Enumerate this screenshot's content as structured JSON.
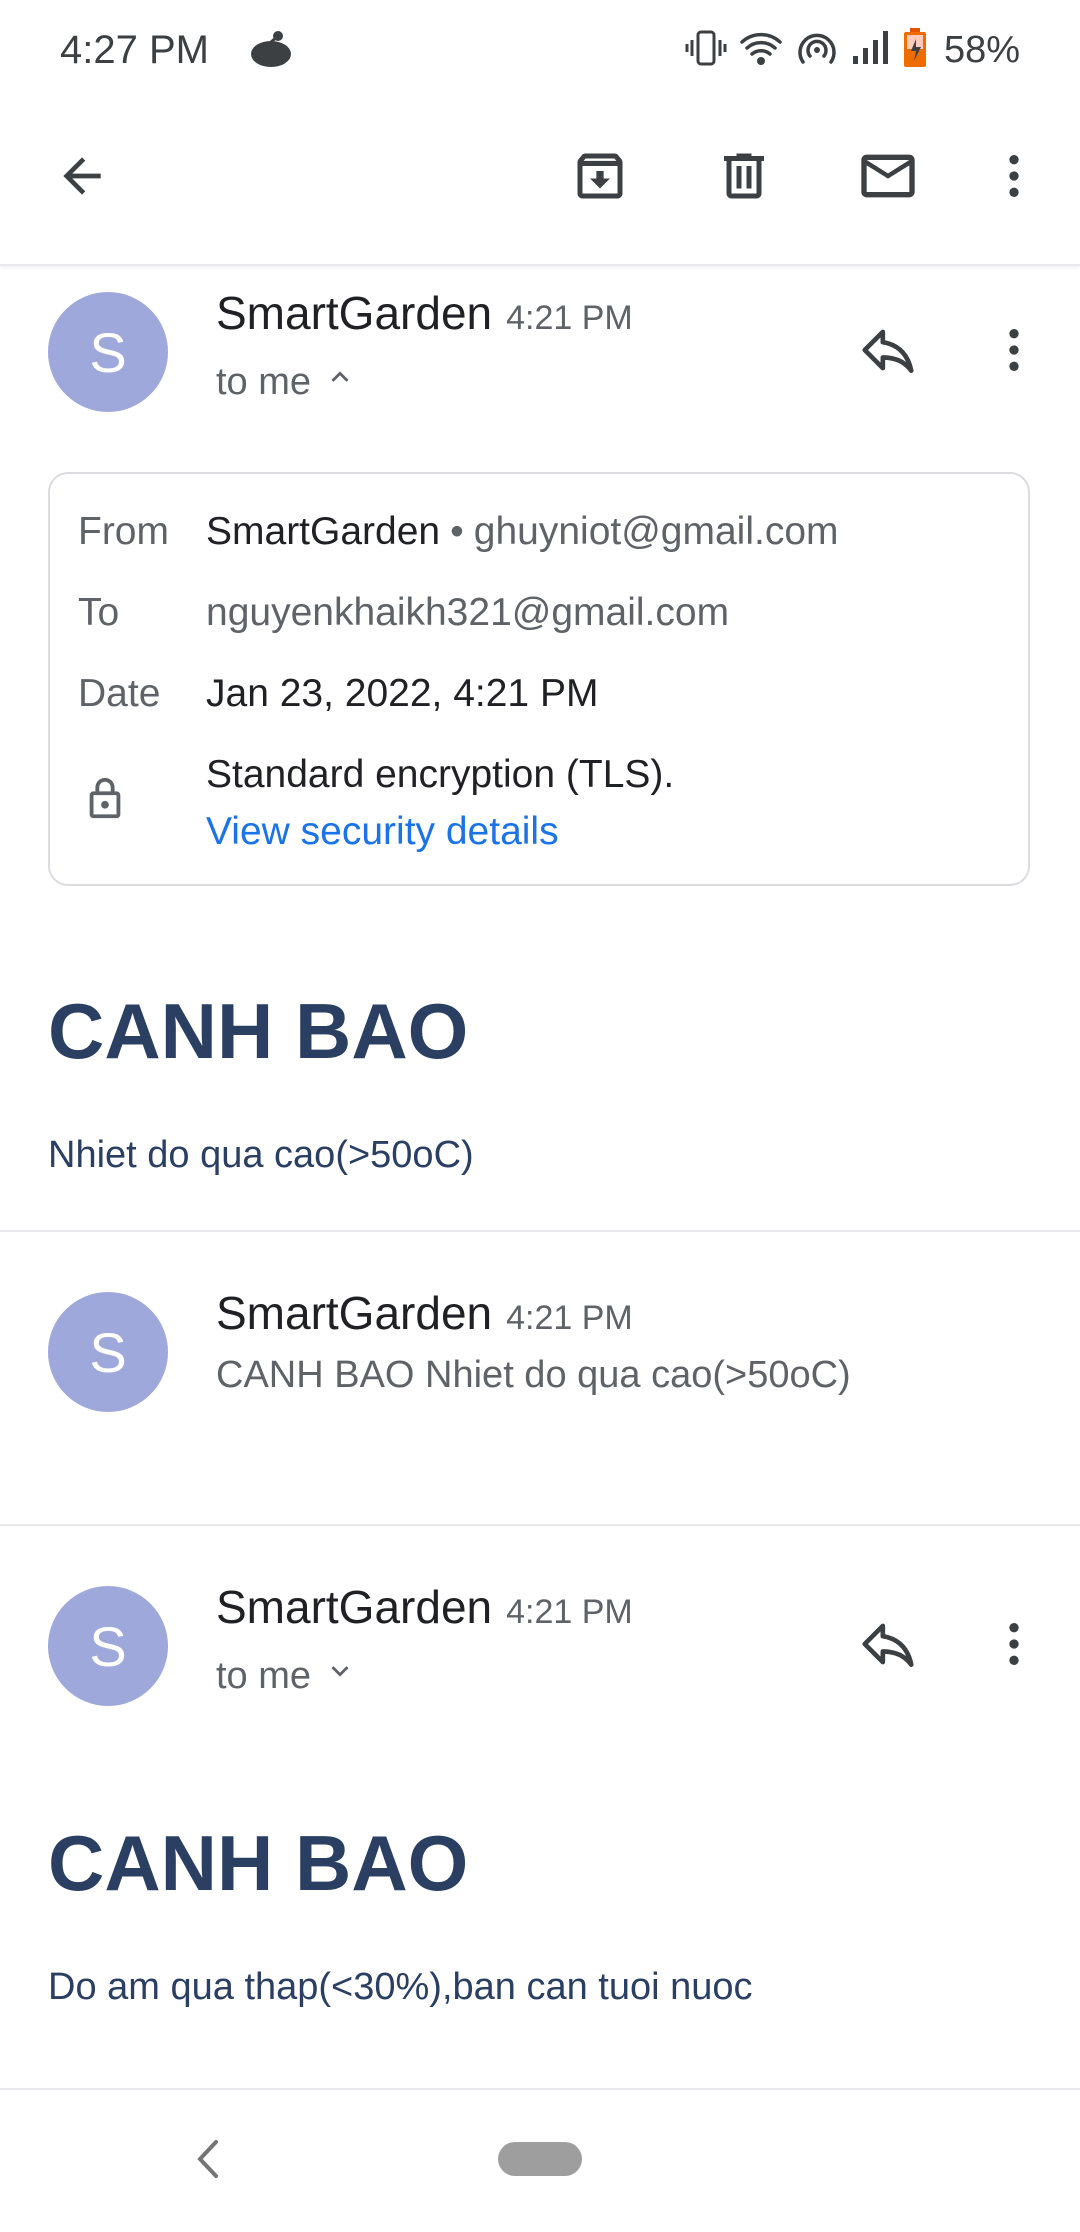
{
  "status_bar": {
    "time": "4:27 PM",
    "battery": "58%"
  },
  "toolbar": {
    "back_icon": "arrow-back-icon",
    "archive_icon": "archive-icon",
    "delete_icon": "trash-icon",
    "mark_unread_icon": "mail-icon",
    "more_icon": "more-vert-icon"
  },
  "messages": [
    {
      "avatar_letter": "S",
      "sender": "SmartGarden",
      "time": "4:21 PM",
      "recipient_label": "to me",
      "expanded": true,
      "details": {
        "from_label": "From",
        "from_name": "SmartGarden",
        "from_separator": "•",
        "from_email": "ghuyniot@gmail.com",
        "to_label": "To",
        "to_email": "nguyenkhaikh321@gmail.com",
        "date_label": "Date",
        "date_value": "Jan 23, 2022, 4:21 PM",
        "encryption": "Standard encryption (TLS).",
        "security_link": "View security details"
      },
      "heading": "CANH BAO",
      "body": "Nhiet do qua cao(>50oC)"
    },
    {
      "avatar_letter": "S",
      "sender": "SmartGarden",
      "time": "4:21 PM",
      "snippet": "CANH BAO Nhiet do qua cao(>50oC)"
    },
    {
      "avatar_letter": "S",
      "sender": "SmartGarden",
      "time": "4:21 PM",
      "recipient_label": "to me",
      "expanded": false,
      "heading": "CANH BAO",
      "body": "Do am qua thap(<30%),ban can tuoi nuoc"
    }
  ],
  "colors": {
    "accent": "#1a73e8",
    "avatar": "#9fa8da",
    "heading": "#2b3f63"
  }
}
